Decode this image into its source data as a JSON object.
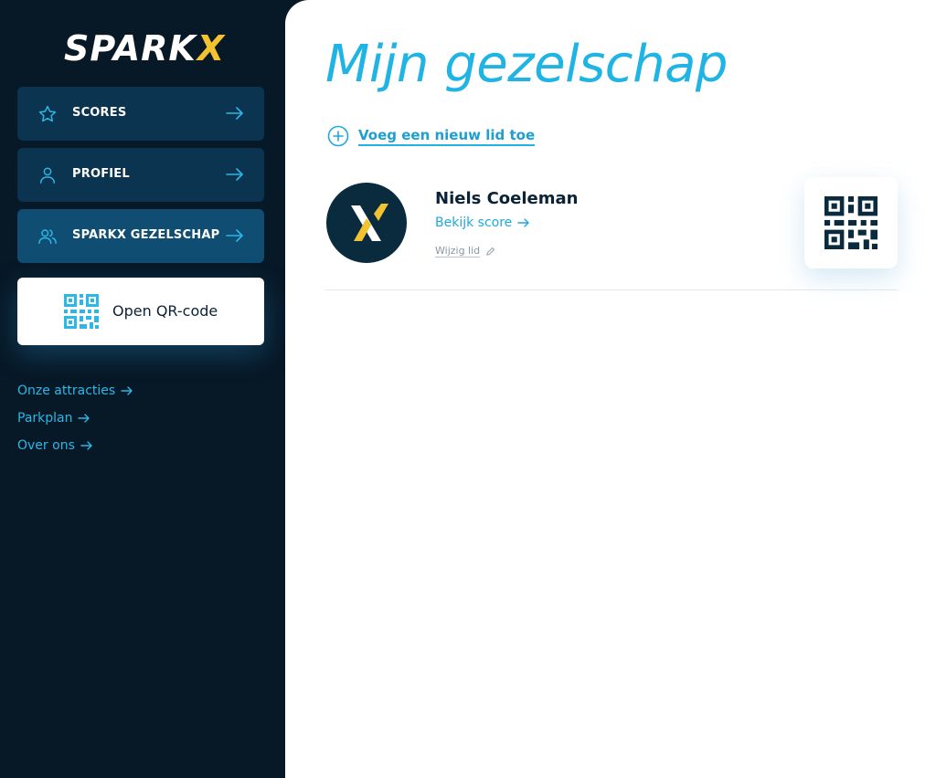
{
  "brand": {
    "logo_text": "SPARK",
    "logo_accent": "X",
    "accent_color": "#f2c230",
    "primary_color": "#1fb4e4",
    "sidebar_bg": "#071826"
  },
  "sidebar": {
    "items": [
      {
        "label": "SCORES",
        "icon": "star-icon"
      },
      {
        "label": "PROFIEL",
        "icon": "user-icon"
      },
      {
        "label": "SPARKX GEZELSCHAP",
        "icon": "users-icon",
        "active": true
      }
    ],
    "qr_button_label": "Open QR-code",
    "links": [
      {
        "label": "Onze attracties"
      },
      {
        "label": "Parkplan"
      },
      {
        "label": "Over ons"
      }
    ]
  },
  "main": {
    "title": "Mijn gezelschap",
    "add_member_label": "Voeg een nieuw lid toe",
    "members": [
      {
        "name": "Niels Coeleman",
        "view_score_label": "Bekijk score",
        "edit_label": "Wijzig lid"
      }
    ]
  }
}
